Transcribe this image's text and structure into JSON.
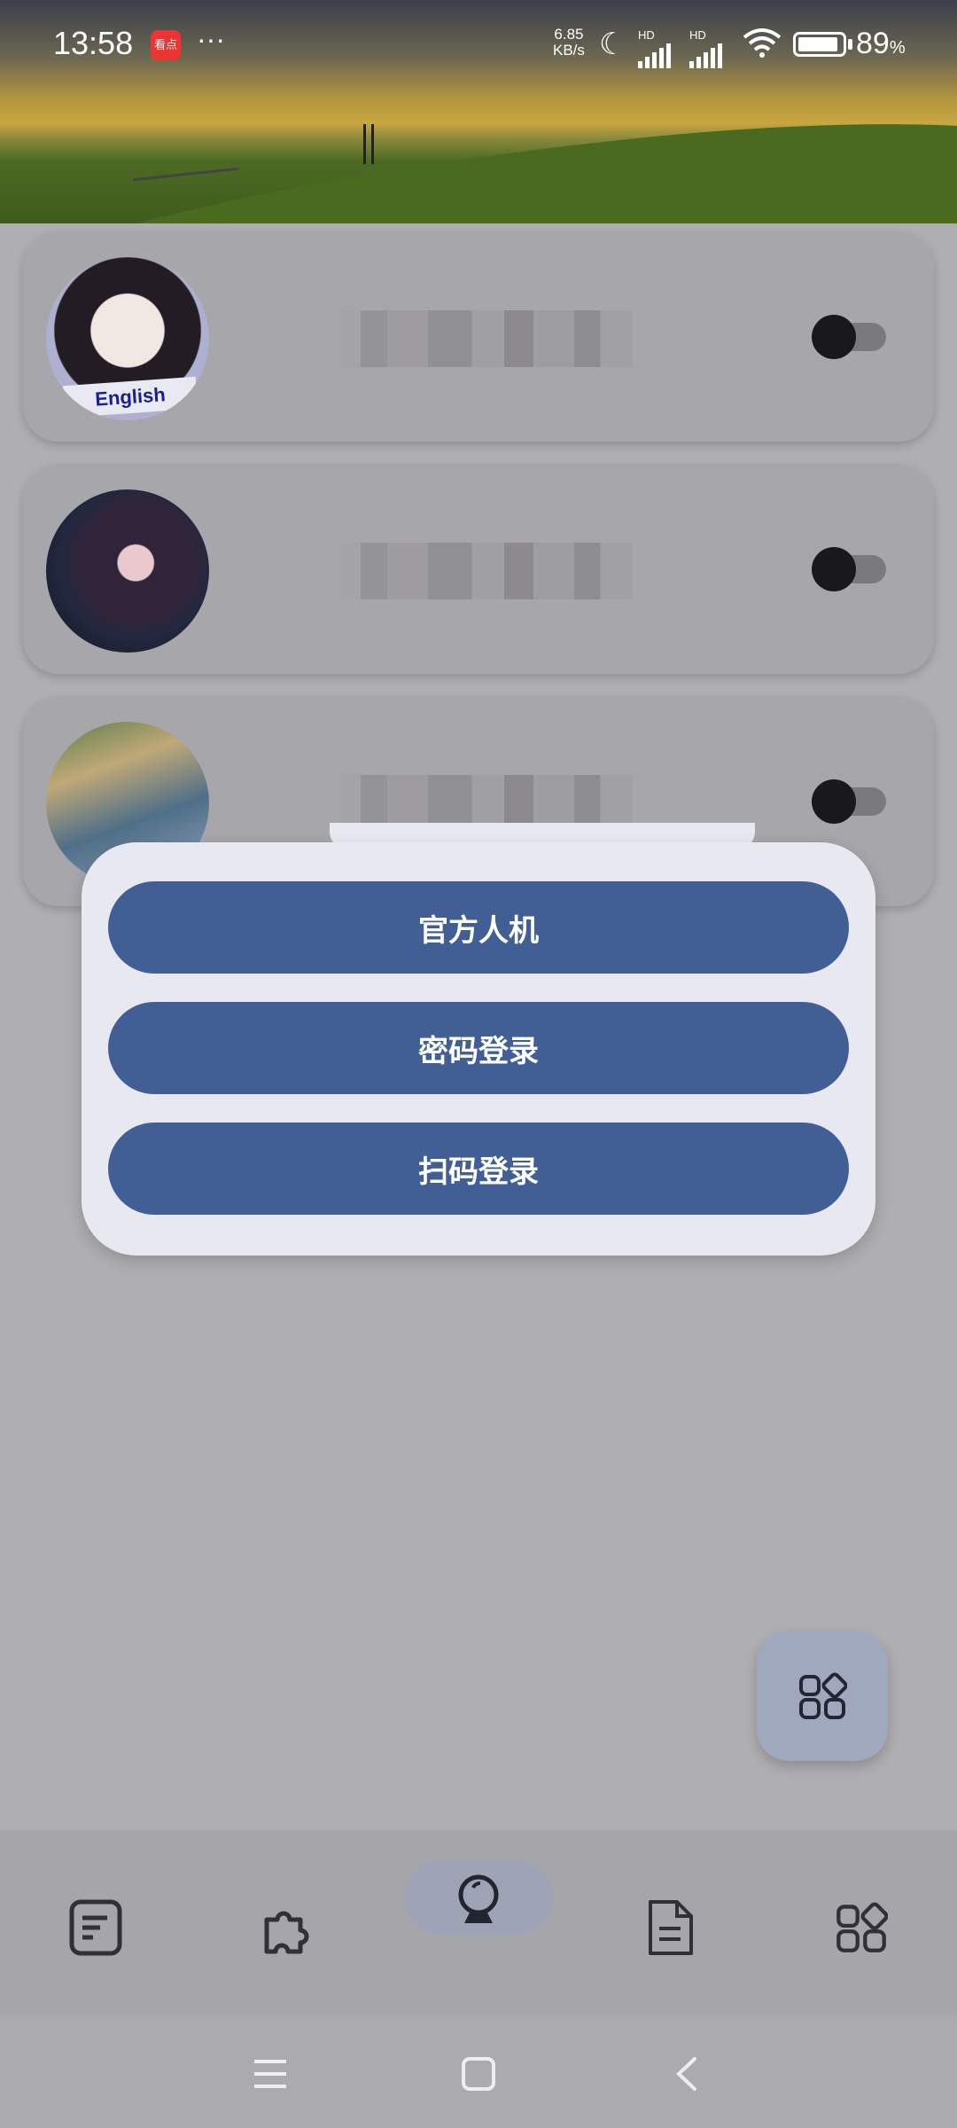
{
  "status_bar": {
    "time": "13:58",
    "app_badge": "看点",
    "more": "···",
    "net_speed_value": "6.85",
    "net_speed_unit": "KB/s",
    "sim1_label": "HD",
    "sim2_label": "HD",
    "battery_percent": "89",
    "battery_unit": "%"
  },
  "accounts": [
    {
      "avatar_label": "English",
      "enabled": false
    },
    {
      "enabled": false
    },
    {
      "enabled": false
    }
  ],
  "login_popup": {
    "buttons": [
      "官方人机",
      "密码登录",
      "扫码登录"
    ]
  },
  "fab": {
    "icon": "apps-icon"
  },
  "bottom_nav": {
    "items": [
      {
        "icon": "notes-icon"
      },
      {
        "icon": "puzzle-icon"
      },
      {
        "icon": "crystal-ball-icon",
        "active": true
      },
      {
        "icon": "document-icon"
      },
      {
        "icon": "apps-icon"
      }
    ]
  },
  "system_nav": [
    "menu-icon",
    "home-icon",
    "back-icon"
  ],
  "colors": {
    "button_blue": "#415f95",
    "popup_bg": "#e8e8f0",
    "scrim": "#afaeb1"
  }
}
